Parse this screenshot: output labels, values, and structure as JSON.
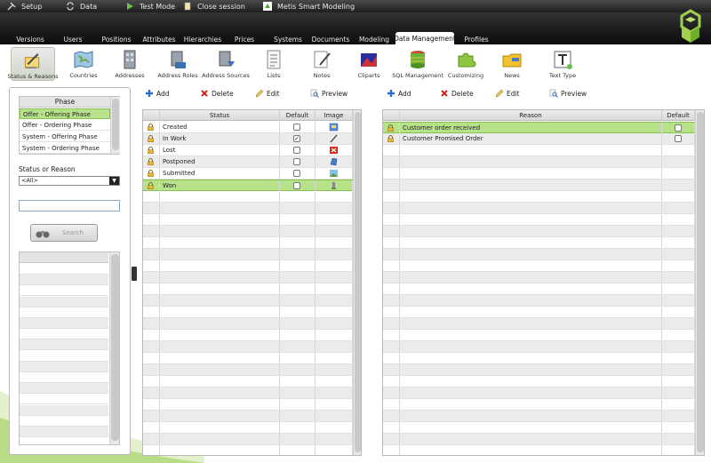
{
  "topbar": {
    "items": [
      {
        "label": "Setup",
        "icon": "tools-icon"
      },
      {
        "label": "Data",
        "icon": "sync-icon"
      },
      {
        "label": "Test Mode",
        "icon": "play-icon"
      },
      {
        "label": "Close session",
        "icon": "document-icon"
      },
      {
        "label": "Metis Smart Modeling",
        "icon": "app-icon"
      }
    ]
  },
  "tabs": [
    "Versions",
    "Users",
    "Positions",
    "Attributes",
    "Hierarchies",
    "Prices",
    "Systems",
    "Documents",
    "Modeling",
    "Data Management",
    "Profiles"
  ],
  "active_tab": "Data Management",
  "tools": [
    {
      "label": "Status & Reasons",
      "icon": "status-reasons-icon"
    },
    {
      "label": "Countries",
      "icon": "map-icon"
    },
    {
      "label": "Addresses",
      "icon": "building-icon"
    },
    {
      "label": "Address Roles",
      "icon": "address-roles-icon"
    },
    {
      "label": "Address Sources",
      "icon": "address-sources-icon"
    },
    {
      "label": "Lists",
      "icon": "list-icon"
    },
    {
      "label": "Notes",
      "icon": "notes-icon"
    },
    {
      "label": "Cliparts",
      "icon": "clipart-icon"
    },
    {
      "label": "SQL Management",
      "icon": "database-icon"
    },
    {
      "label": "Customizing",
      "icon": "puzzle-icon"
    },
    {
      "label": "News",
      "icon": "news-folder-icon"
    },
    {
      "label": "Text Type",
      "icon": "text-type-icon"
    }
  ],
  "sidebar": {
    "phase_header": "Phase",
    "phases": [
      "Offer - Offering Phase",
      "Offer - Ordering Phase",
      "System - Offering Phase",
      "System - Ordering Phase"
    ],
    "selected_phase": 0,
    "filter_label": "Status or Reason",
    "filter_value": "<All>",
    "search_value": "",
    "search_button": "Search"
  },
  "status_actions": {
    "add": "Add",
    "delete": "Delete",
    "edit": "Edit",
    "preview": "Preview"
  },
  "status_grid": {
    "headers": {
      "status": "Status",
      "default": "Default",
      "image": "Image"
    },
    "rows": [
      {
        "status": "Created",
        "default": false,
        "image": "created-image-icon"
      },
      {
        "status": "In Work",
        "default": true,
        "image": "pen-icon"
      },
      {
        "status": "Lost",
        "default": false,
        "image": "red-x-icon"
      },
      {
        "status": "Postponed",
        "default": false,
        "image": "postponed-image-icon"
      },
      {
        "status": "Submitted",
        "default": false,
        "image": "submitted-image-icon"
      },
      {
        "status": "Won",
        "default": false,
        "image": "trophy-icon"
      }
    ],
    "selected_row": 5
  },
  "reason_actions": {
    "add": "Add",
    "delete": "Delete",
    "edit": "Edit",
    "preview": "Preview"
  },
  "reason_grid": {
    "headers": {
      "reason": "Reason",
      "default": "Default"
    },
    "rows": [
      {
        "reason": "Customer order received",
        "default": false
      },
      {
        "reason": "Customer Promised Order",
        "default": false
      }
    ],
    "selected_row": 0
  },
  "colors": {
    "accent_green": "#b7e28a",
    "header_dark": "#1a1a1a"
  }
}
